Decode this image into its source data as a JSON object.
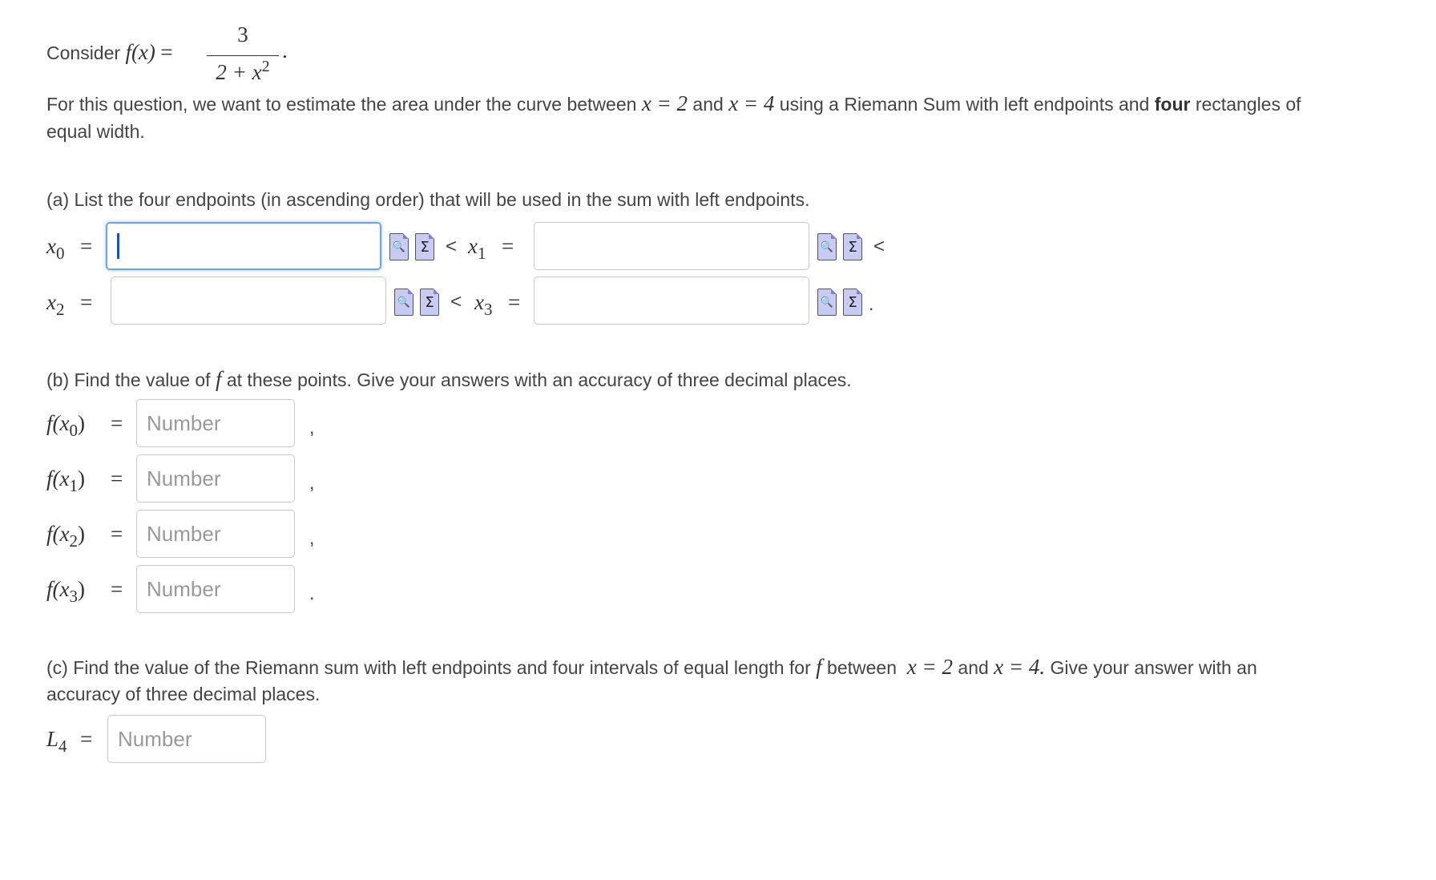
{
  "intro": {
    "consider": "Consider",
    "f_lhs": "f(x)",
    "eq": "=",
    "numerator": "3",
    "denominator_base": "2 + x",
    "denominator_exp": "2",
    "period": ".",
    "question_part1": "For this question, we want to estimate the area under the curve between",
    "x_eq_2": "x = 2",
    "and": "and",
    "x_eq_4": "x = 4",
    "question_part2": "using a Riemann Sum with left endpoints and",
    "four_bold": "four",
    "question_part3": "rectangles of",
    "question_line2": "equal width."
  },
  "part_a": {
    "prompt": "(a) List the four endpoints (in ascending order) that will be used in the sum with left endpoints.",
    "x": "x",
    "sub0": "0",
    "sub1": "1",
    "sub2": "2",
    "sub3": "3",
    "eq": "=",
    "lt": "<",
    "period": ".",
    "x0_value": "",
    "x1_value": "",
    "x2_value": "",
    "x3_value": ""
  },
  "part_b": {
    "prompt_before": "(b) Find the value of",
    "f": "f",
    "prompt_after": "at these points. Give your answers with an accuracy of three decimal places.",
    "placeholder": "Number",
    "fx0": "f(x",
    "close": ")",
    "eq": "=",
    "comma": ",",
    "period": "."
  },
  "part_c": {
    "prompt_before": "(c) Find the value of the Riemann sum with left endpoints and four intervals of equal length for",
    "f": "f",
    "between": "between",
    "x_eq_2": "x = 2",
    "and": "and",
    "x_eq_4": "x = 4.",
    "prompt_after": "Give your answer with an",
    "line2": "accuracy of three decimal places.",
    "L": "L",
    "L_sub": "4",
    "eq": "=",
    "placeholder": "Number"
  },
  "icons": {
    "preview": "preview-icon",
    "equation": "equation-editor-icon",
    "preview_glyph": "🔍",
    "sigma_glyph": "Σ"
  }
}
